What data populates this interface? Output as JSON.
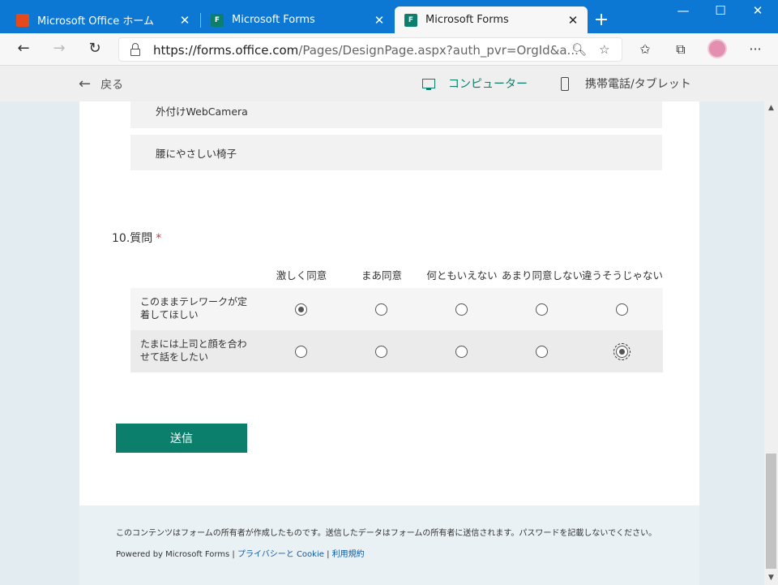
{
  "browser": {
    "tabs": [
      {
        "label": "Microsoft Office ホーム",
        "icon": "office-icon",
        "active": false
      },
      {
        "label": "Microsoft Forms",
        "icon": "forms-icon",
        "active": false
      },
      {
        "label": "Microsoft Forms",
        "icon": "forms-icon",
        "active": true
      }
    ],
    "close_glyph": "✕",
    "new_tab_glyph": "+",
    "url_host": "https://forms.office.com",
    "url_path": "/Pages/DesignPage.aspx?auth_pvr=OrgId&a...",
    "colors": {
      "titlebar": "#0c78d4",
      "accent": "#0b7f6b"
    }
  },
  "preview": {
    "back_label": "戻る",
    "modes": [
      {
        "label": "コンピューター",
        "active": true
      },
      {
        "label": "携帯電話/タブレット",
        "active": false
      }
    ]
  },
  "form": {
    "prev_options": [
      "外付けWebCamera",
      "腰にやさしい椅子"
    ],
    "question": {
      "number": "10.",
      "title": "質問",
      "required_mark": "*",
      "columns": [
        "激しく同意",
        "まあ同意",
        "何ともいえない",
        "あまり同意しない",
        "違うそうじゃない"
      ],
      "rows": [
        {
          "label": "このままテレワークが定着してほしい",
          "selected": 0
        },
        {
          "label": "たまには上司と顔を合わせて話をしたい",
          "selected": 4
        }
      ]
    },
    "submit_label": "送信"
  },
  "footer": {
    "disclaimer": "このコンテンツはフォームの所有者が作成したものです。送信したデータはフォームの所有者に送信されます。パスワードを記載しないでください。",
    "powered_by": "Powered by Microsoft Forms",
    "separator": " | ",
    "privacy": "プライバシーと Cookie",
    "terms": "利用規約"
  }
}
